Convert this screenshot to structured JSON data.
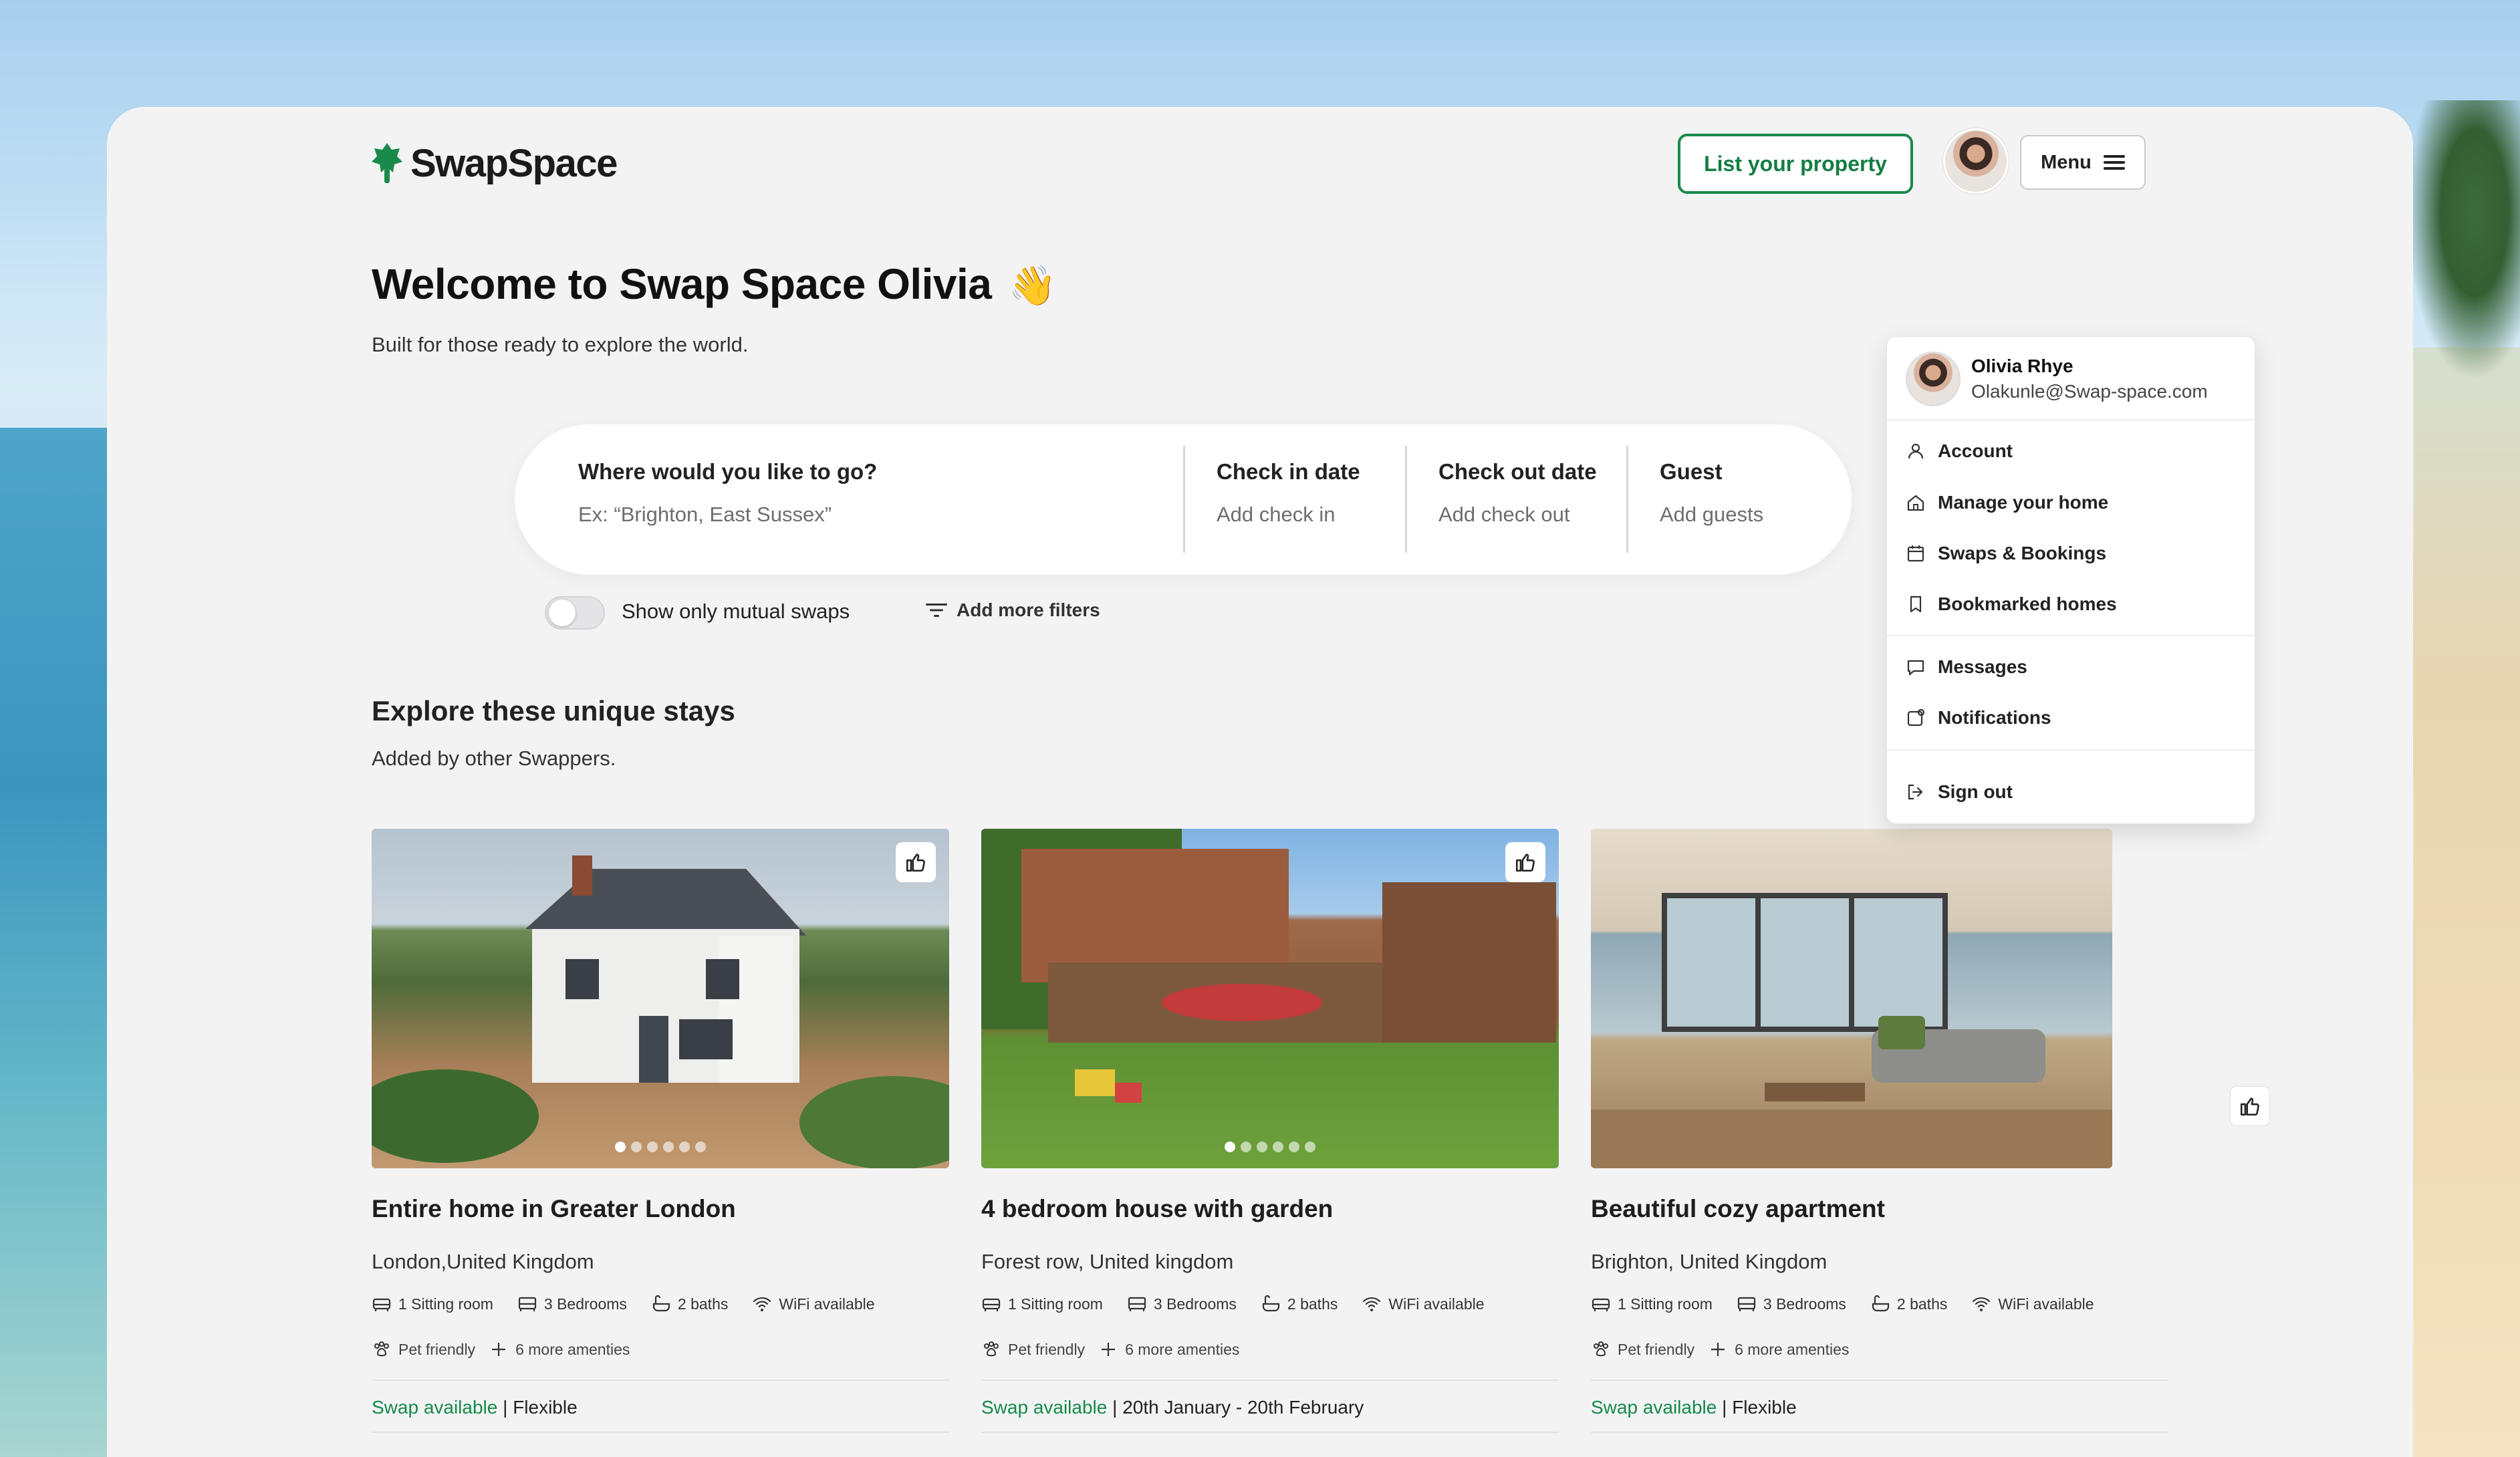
{
  "app": {
    "logo_text": "SwapSpace",
    "accent": "#1a8a4b"
  },
  "header": {
    "list_property": "List your property",
    "menu": "Menu"
  },
  "welcome": {
    "title": "Welcome to Swap Space Olivia",
    "emoji": "👋",
    "subtitle": "Built for those ready to explore the world."
  },
  "search": {
    "destination": {
      "label": "Where would you like to go?",
      "placeholder": "Ex: “Brighton, East Sussex”"
    },
    "checkin": {
      "label": "Check in date",
      "placeholder": "Add check in"
    },
    "checkout": {
      "label": "Check out date",
      "placeholder": "Add check out"
    },
    "guest": {
      "label": "Guest",
      "placeholder": "Add guests"
    }
  },
  "filters": {
    "toggle_label": "Show only mutual swaps",
    "toggle_on": false,
    "more_filters": "Add more filters"
  },
  "section": {
    "title": "Explore these unique stays",
    "subtitle": "Added by other Swappers."
  },
  "cards": [
    {
      "title": "Entire home in Greater London",
      "location": "London,United Kingdom",
      "sitting": "1 Sitting room",
      "bedrooms": "3 Bedrooms",
      "baths": "2 baths",
      "wifi": "WiFi available",
      "pet": "Pet friendly",
      "more": "6 more amenties",
      "swap": "Swap available",
      "sep": " | ",
      "dates": "Flexible"
    },
    {
      "title": "4 bedroom house with garden",
      "location": "Forest row, United kingdom",
      "sitting": "1 Sitting room",
      "bedrooms": "3 Bedrooms",
      "baths": "2 baths",
      "wifi": "WiFi available",
      "pet": "Pet friendly",
      "more": "6 more amenties",
      "swap": "Swap available",
      "sep": " | ",
      "dates": "20th January - 20th February"
    },
    {
      "title": "Beautiful cozy apartment",
      "location": "Brighton, United Kingdom",
      "sitting": "1 Sitting room",
      "bedrooms": "3 Bedrooms",
      "baths": "2 baths",
      "wifi": "WiFi available",
      "pet": "Pet friendly",
      "more": "6 more amenties",
      "swap": "Swap available",
      "sep": " | ",
      "dates": "Flexible"
    }
  ],
  "dropdown": {
    "name": "Olivia Rhye",
    "email": "Olakunle@Swap-space.com",
    "items": [
      "Account",
      "Manage your home",
      "Swaps & Bookings",
      "Bookmarked homes",
      "Messages",
      "Notifications",
      "Sign out"
    ]
  }
}
